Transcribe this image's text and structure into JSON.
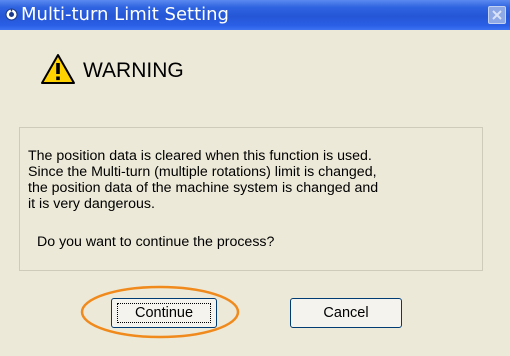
{
  "window": {
    "title": "Multi-turn Limit Setting",
    "title_icon": "app-icon",
    "close_icon": "close-icon"
  },
  "warning": {
    "icon": "warning-triangle-icon",
    "label": "WARNING"
  },
  "message": {
    "lines": [
      "The position data is cleared when this function is used.",
      "Since the Multi-turn (multiple rotations) limit is changed,",
      "the position data of the machine system is changed and",
      "it is very dangerous."
    ],
    "question": "Do you want to continue the process?"
  },
  "buttons": {
    "continue_label": "Continue",
    "cancel_label": "Cancel"
  },
  "colors": {
    "titlebar": "#2456d6",
    "dialog_bg": "#ece9d8",
    "highlight": "#f08a1c",
    "warning_yellow": "#ffd200"
  }
}
